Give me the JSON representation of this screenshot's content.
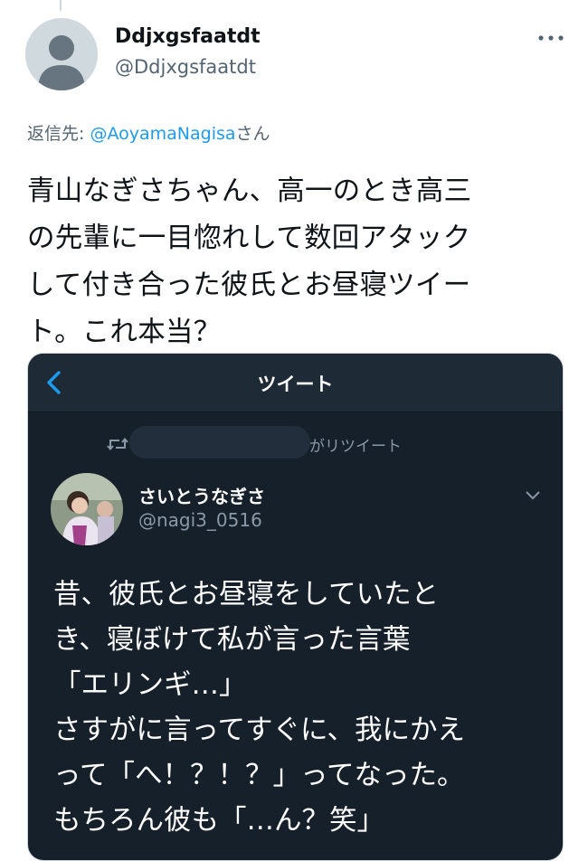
{
  "author": {
    "display_name": "Ddjxgsfaatdt",
    "handle": "@Ddjxgsfaatdt",
    "avatar_icon": "default-avatar-icon"
  },
  "more_icon": "more-horizontal-icon",
  "reply": {
    "prefix": "返信先: ",
    "mention": "@AoyamaNagisa",
    "suffix": "さん"
  },
  "tweet_lines": [
    "青山なぎさちゃん、高一のとき高三",
    "の先輩に一目惚れして数回アタック",
    "して付き合った彼氏とお昼寝ツイー",
    "ト。これ本当？"
  ],
  "embedded": {
    "header_title": "ツイート",
    "back_icon": "chevron-left-icon",
    "retweet_icon": "retweet-icon",
    "retweeted_by_suffix": "がリツイート",
    "name": "さいとうなぎさ",
    "handle": "@nagi3_0516",
    "lines": [
      "昔、彼氏とお昼寝をしていたと",
      "き、寝ぼけて私が言った言葉",
      "「エリンギ…」",
      "さすがに言ってすぐに、我にかえ",
      "って「へ！？！？」ってなった。",
      "もちろん彼も「…ん？笑」"
    ]
  },
  "colors": {
    "link": "#1d9bf0",
    "secondary_text": "#536471",
    "dark_bg": "#15202b",
    "dark_header": "#1e2a36"
  }
}
